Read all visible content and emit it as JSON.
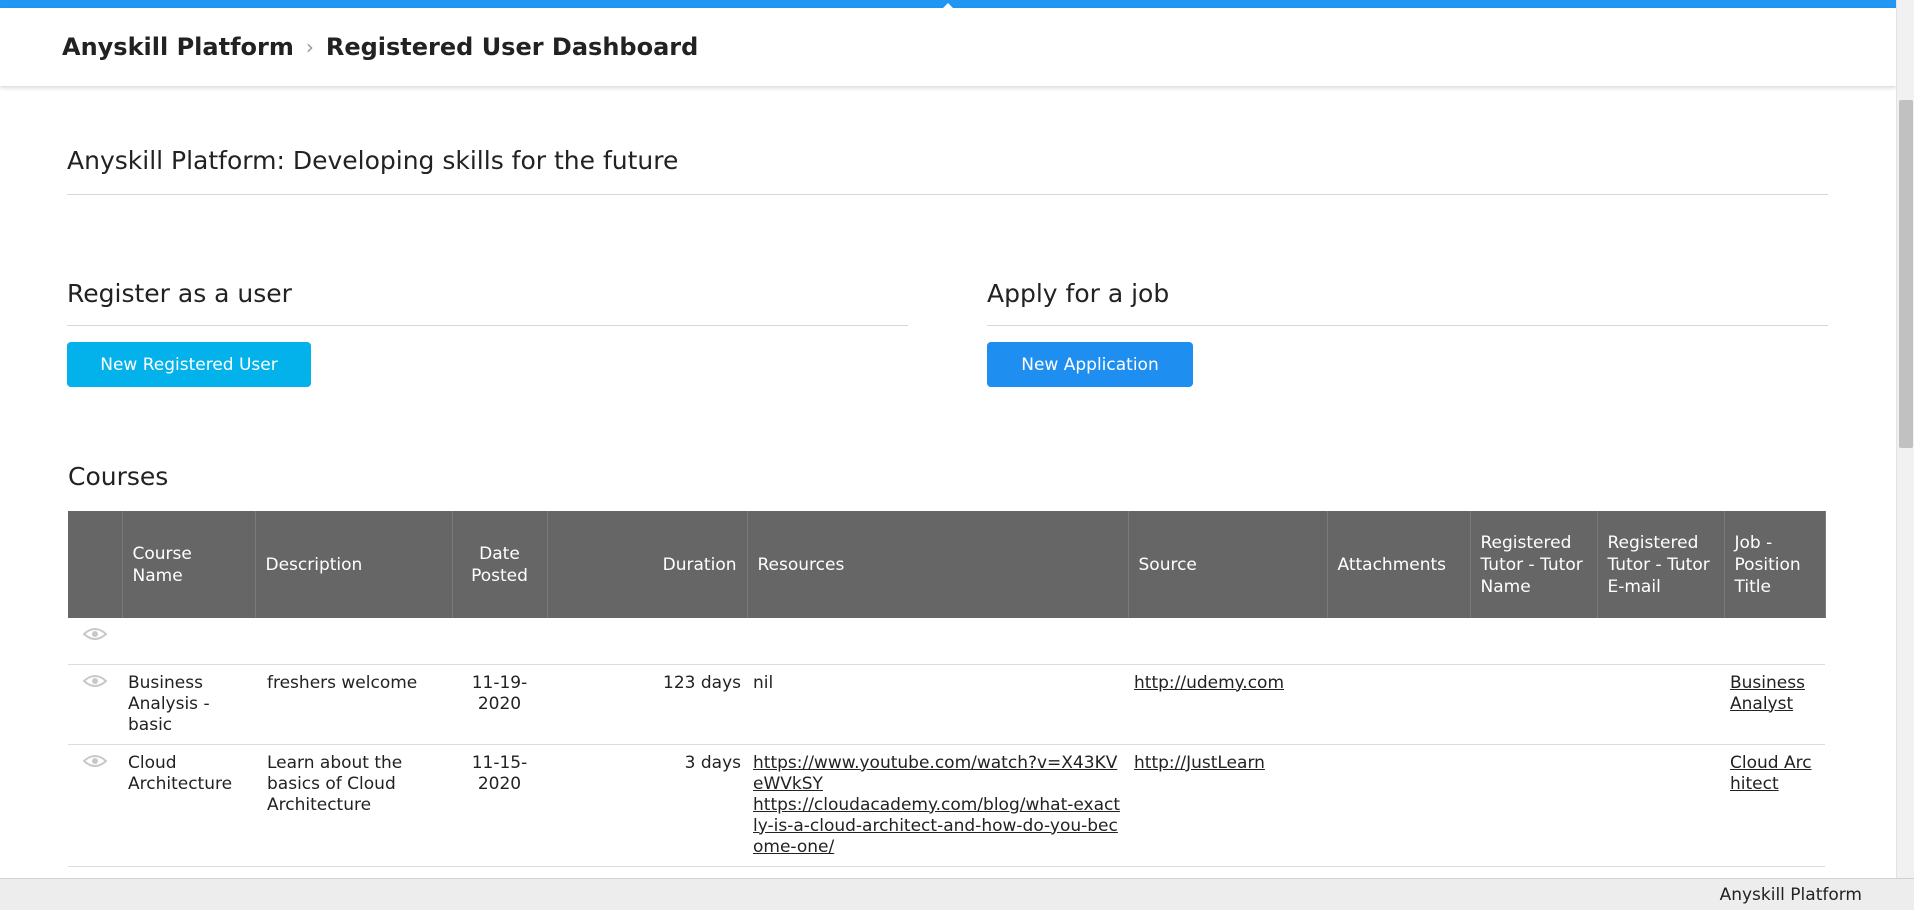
{
  "header": {
    "breadcrumb": [
      "Anyskill Platform",
      "Registered User Dashboard"
    ]
  },
  "page": {
    "title": "Anyskill Platform: Developing skills for the future"
  },
  "register": {
    "title": "Register as a user",
    "button": "New Registered User"
  },
  "apply": {
    "title": "Apply for a job",
    "button": "New Application"
  },
  "courses": {
    "title": "Courses",
    "columns": [
      "",
      "Course Name",
      "Description",
      "Date Posted",
      "Duration",
      "Resources",
      "Source",
      "Attachments",
      "Registered Tutor - Tutor Name",
      "Registered Tutor - Tutor E-mail",
      "Job - Position Title"
    ],
    "rows": [
      {
        "name": "Business Analysis - basic",
        "description": "freshers welcome",
        "date": "11-19-2020",
        "duration": "123 days",
        "resources": [
          "nil"
        ],
        "source": "http://udemy.com",
        "attachments": "",
        "tutor_name": "",
        "tutor_email": "",
        "job": "Business Analyst"
      },
      {
        "name": "Cloud Architecture",
        "description": "Learn about the basics of Cloud Architecture",
        "date": "11-15-2020",
        "duration": "3 days",
        "resources": [
          "https://www.youtube.com/watch?v=X43KVeWVkSY",
          "https://cloudacademy.com/blog/what-exactly-is-a-cloud-architect-and-how-do-you-become-one/"
        ],
        "source": "http://JustLearn",
        "attachments": "",
        "tutor_name": "",
        "tutor_email": "",
        "job": "Cloud Architect"
      }
    ]
  },
  "footer": {
    "text": "Anyskill Platform"
  },
  "colors": {
    "accent": "#2196f3",
    "button_user": "#03b2ea",
    "button_app": "#1e8ff0",
    "table_header": "#666666"
  },
  "icons": [
    "arrow-up-icon",
    "eye-icon",
    "chevron-right-icon"
  ]
}
